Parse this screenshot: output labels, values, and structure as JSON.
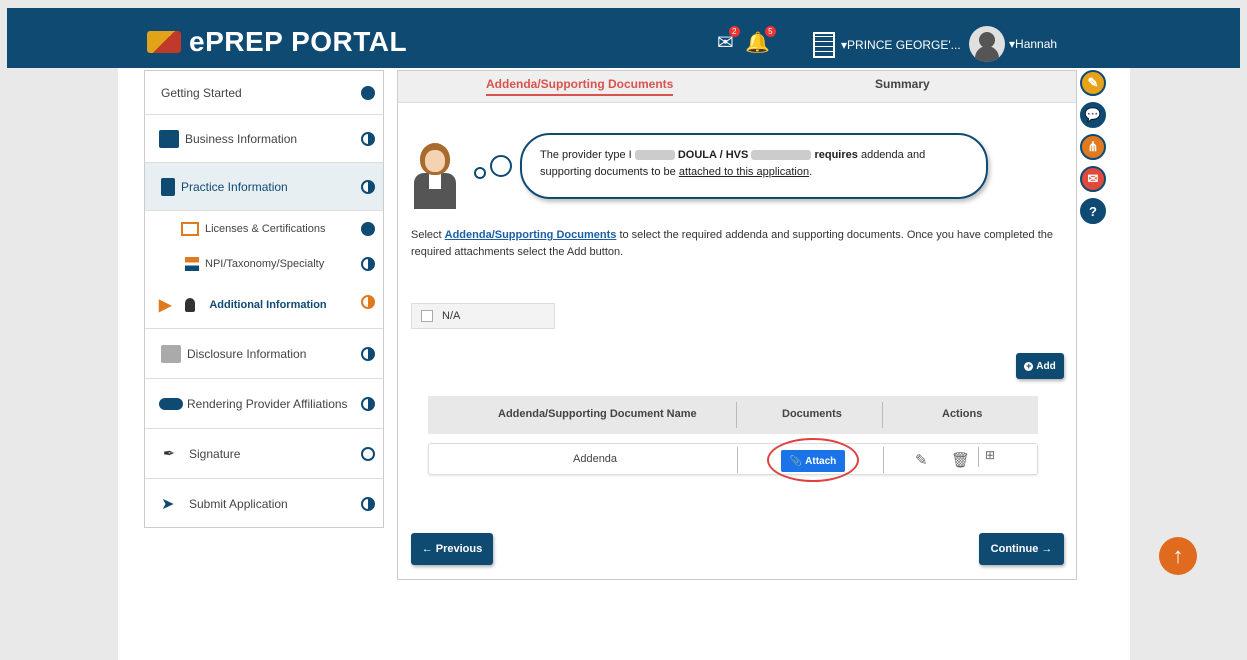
{
  "header": {
    "logo_text": "ePREP PORTAL",
    "mail_badge": "2",
    "bell_badge": "5",
    "location": "PRINCE GEORGE'...",
    "user": "Hannah"
  },
  "sidebar": {
    "items": [
      {
        "label": "Getting Started",
        "status": "full"
      },
      {
        "label": "Business Information",
        "status": "half"
      },
      {
        "label": "Practice Information",
        "status": "half"
      },
      {
        "label": "Licenses & Certifications",
        "status": "full"
      },
      {
        "label": "NPI/Taxonomy/Specialty",
        "status": "half"
      },
      {
        "label": "Additional Information",
        "status": "half-orange"
      },
      {
        "label": "Disclosure Information",
        "status": "half"
      },
      {
        "label": "Rendering Provider Affiliations",
        "status": "half"
      },
      {
        "label": "Signature",
        "status": "empty"
      },
      {
        "label": "Submit Application",
        "status": "half"
      }
    ]
  },
  "tabs": {
    "active": "Addenda/Supporting Documents",
    "next": "Summary"
  },
  "speech": {
    "prefix": "The provider type I",
    "provider_type": "DOULA / HVS",
    "requires": "requires",
    "line1_rest": "addenda and",
    "line2_start": "supporting documents to be",
    "link": "attached to this application",
    "period": "."
  },
  "instructions": {
    "before": "Select",
    "link": "Addenda/Supporting Documents",
    "after": "to select the required addenda and supporting documents. Once you have completed the required attachments select the Add button."
  },
  "na_label": "N/A",
  "add_button": "Add",
  "table": {
    "headers": [
      "Addenda/Supporting Document Name",
      "Documents",
      "Actions"
    ],
    "rows": [
      {
        "name": "Addenda",
        "document_button": "Attach"
      }
    ]
  },
  "buttons": {
    "previous": "Previous",
    "continue": "Continue"
  },
  "colors": {
    "primary": "#0f4a73",
    "accent_orange": "#e07a1f",
    "active_tab": "#d9534f",
    "attach_blue": "#1a73e8"
  }
}
